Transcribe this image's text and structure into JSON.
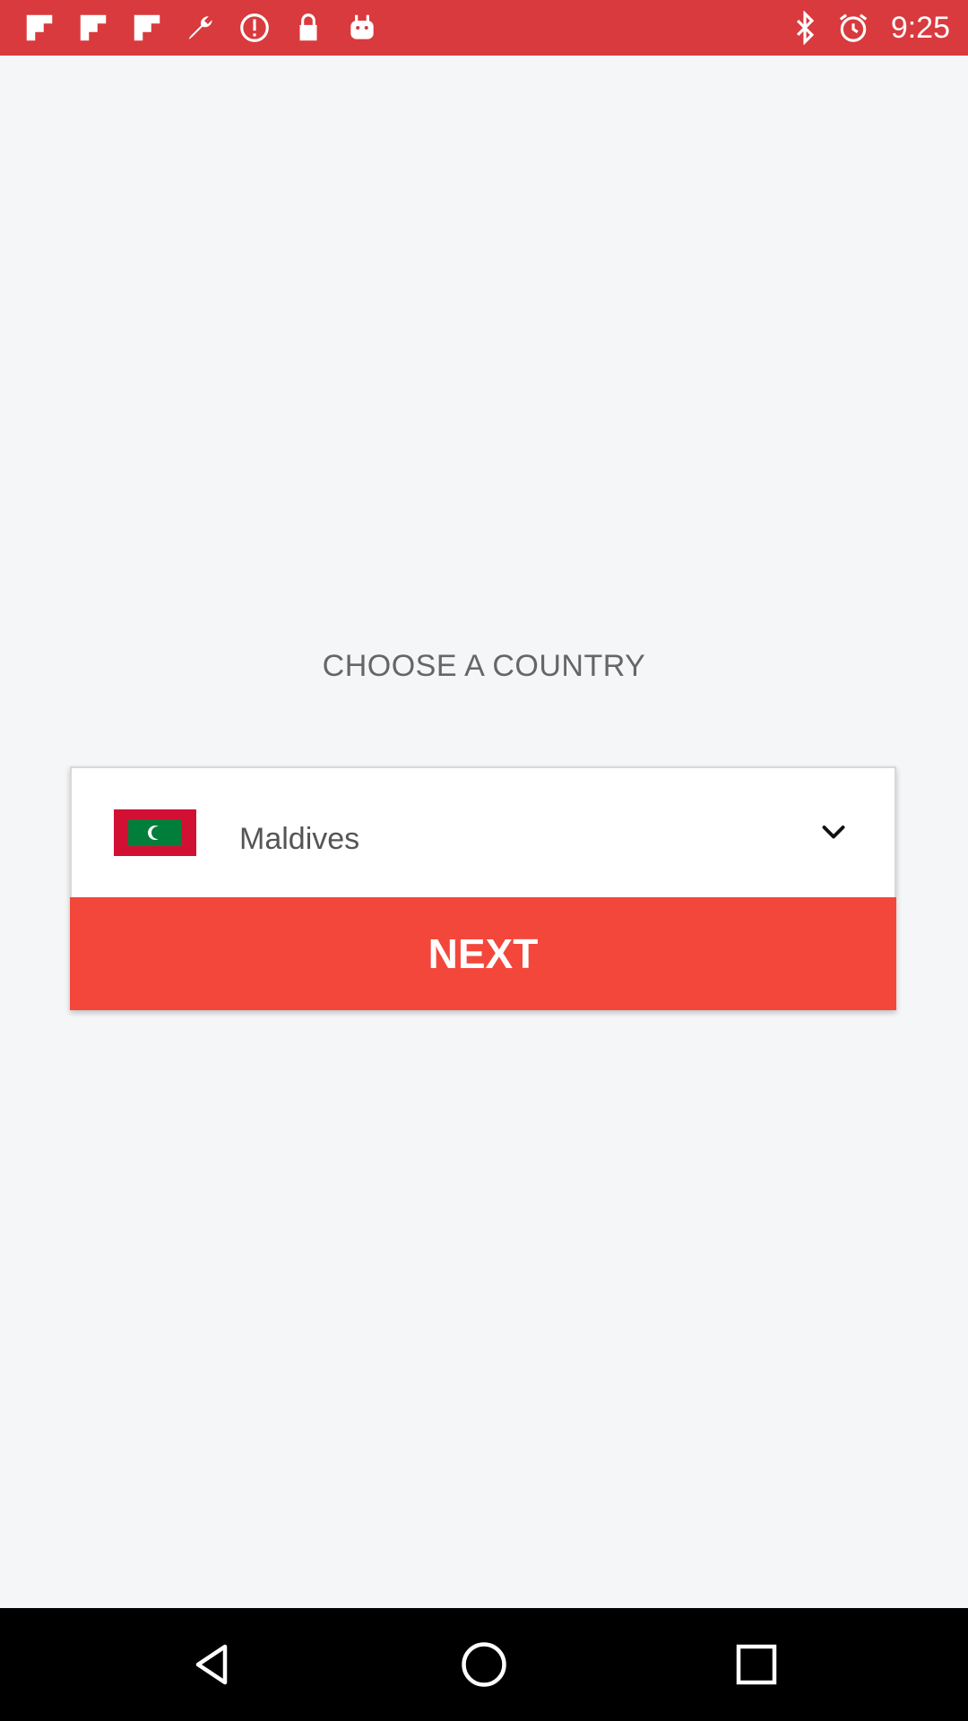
{
  "status_bar": {
    "background": "#d83a3d",
    "left_icons": [
      "flipboard-icon",
      "flipboard-icon",
      "flipboard-icon",
      "wrench-icon",
      "alert-icon",
      "lock-icon",
      "android-icon"
    ],
    "right_icons": [
      "bluetooth-icon",
      "alarm-icon"
    ],
    "time": "9:25"
  },
  "page": {
    "title": "CHOOSE A COUNTRY"
  },
  "country_picker": {
    "selected_country": "Maldives",
    "flag": "maldives-flag",
    "dropdown_icon": "chevron-down-icon"
  },
  "actions": {
    "next_label": "NEXT",
    "next_color": "#f4473b"
  },
  "nav_bar": {
    "buttons": [
      "back-icon",
      "home-icon",
      "recents-icon"
    ]
  }
}
